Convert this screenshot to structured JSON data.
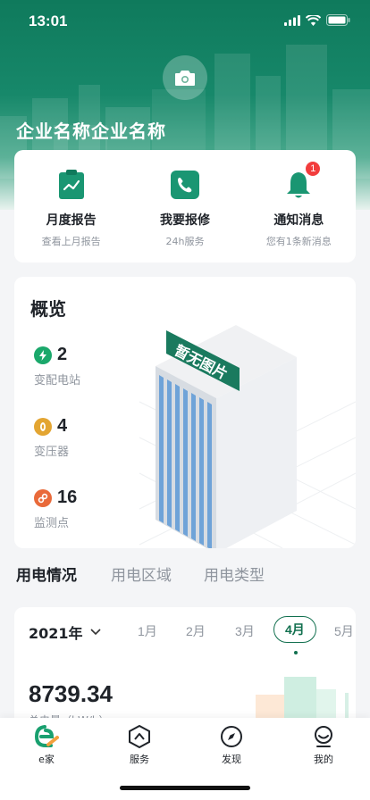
{
  "status_bar": {
    "time": "13:01"
  },
  "header": {
    "company_name": "企业名称企业名称"
  },
  "quick_actions": [
    {
      "title": "月度报告",
      "subtitle": "查看上月报告",
      "icon": "report-icon"
    },
    {
      "title": "我要报修",
      "subtitle": "24h服务",
      "icon": "phone-icon"
    },
    {
      "title": "通知消息",
      "subtitle": "您有1条新消息",
      "icon": "bell-icon",
      "badge": "1"
    }
  ],
  "overview": {
    "title": "概览",
    "placeholder_text": "暂无图片",
    "stats": [
      {
        "value": "2",
        "label": "变配电站",
        "icon": "lightning-icon",
        "color": "#1aa86b"
      },
      {
        "value": "4",
        "label": "变压器",
        "icon": "eye-icon",
        "color": "#e3a532"
      },
      {
        "value": "16",
        "label": "监测点",
        "icon": "link-icon",
        "color": "#e96a3a"
      }
    ]
  },
  "tabs": [
    {
      "label": "用电情况",
      "active": true
    },
    {
      "label": "用电区域",
      "active": false
    },
    {
      "label": "用电类型",
      "active": false
    }
  ],
  "usage": {
    "year": "2021年",
    "months": [
      "1月",
      "2月",
      "3月",
      "4月",
      "5月"
    ],
    "selected_month": "4月",
    "value": "8739.34",
    "label": "总电量（kW/h）"
  },
  "tabbar": [
    {
      "label": "e家",
      "icon": "home-icon",
      "active": true
    },
    {
      "label": "服务",
      "icon": "service-icon",
      "active": false
    },
    {
      "label": "发现",
      "icon": "compass-icon",
      "active": false
    },
    {
      "label": "我的",
      "icon": "profile-icon",
      "active": false
    }
  ],
  "colors": {
    "primary": "#12704f",
    "badge": "#f23d3d"
  }
}
